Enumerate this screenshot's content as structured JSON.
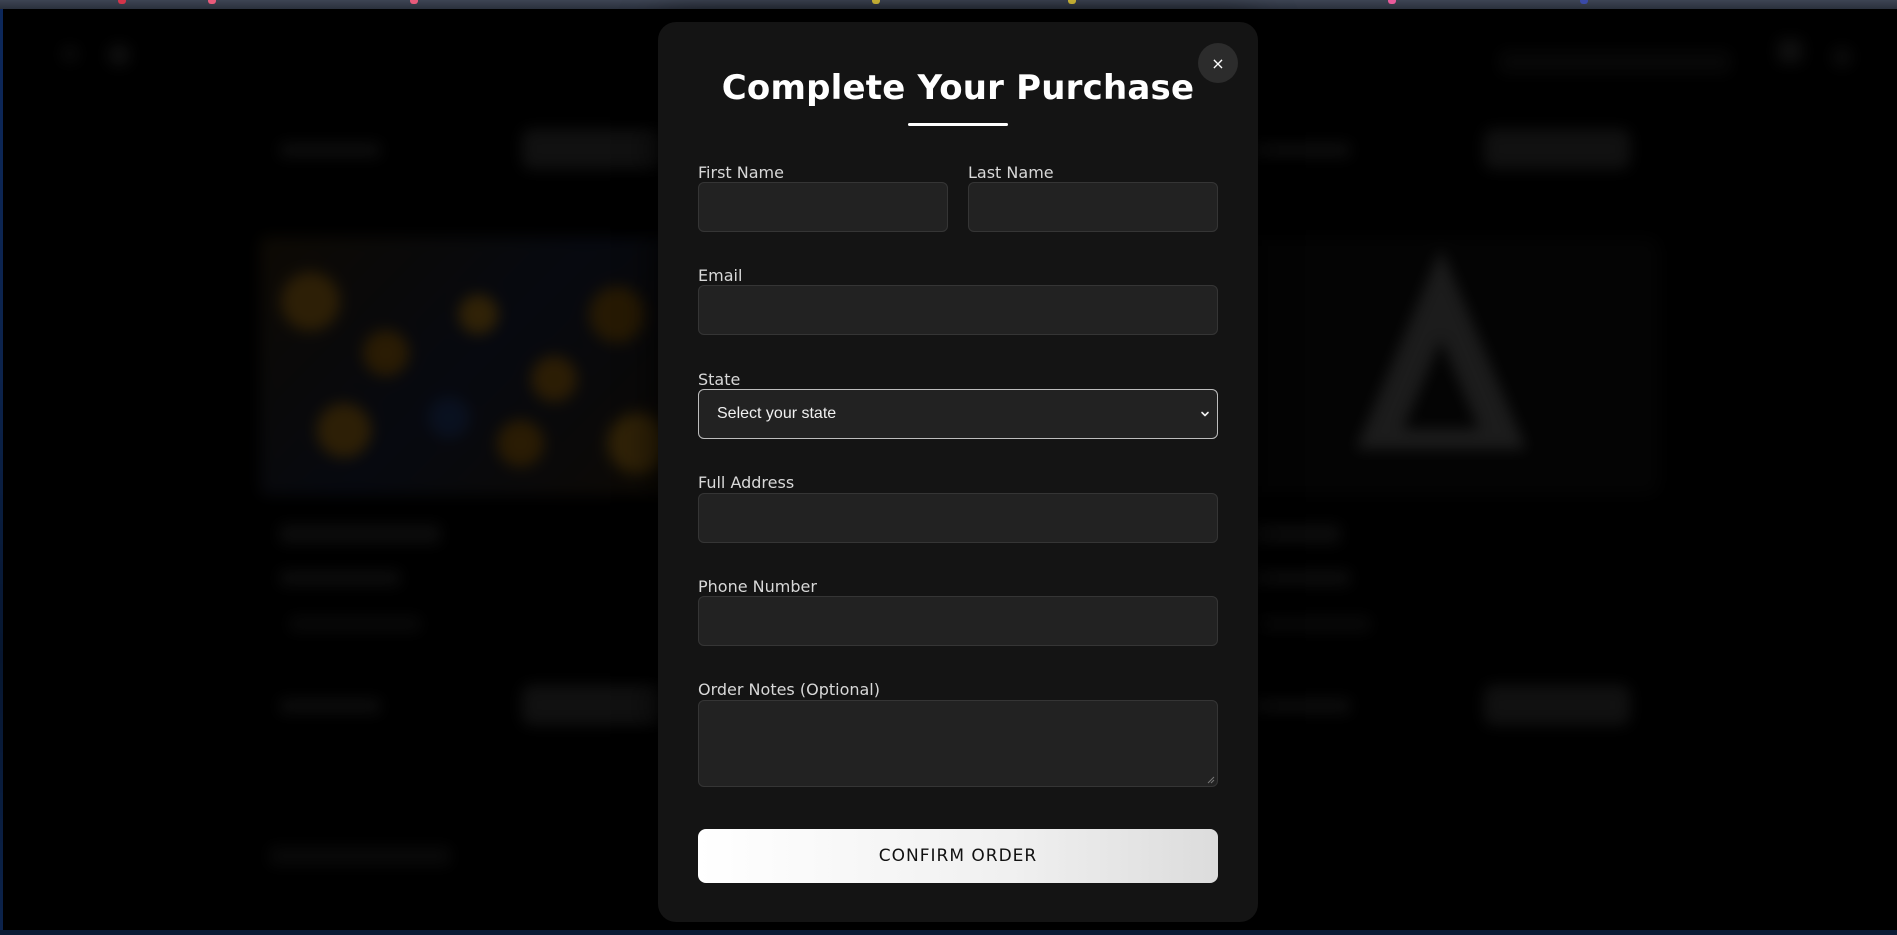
{
  "modal": {
    "title": "Complete Your Purchase",
    "close_label": "×",
    "fields": {
      "first_name": {
        "label": "First Name",
        "value": "",
        "placeholder": ""
      },
      "last_name": {
        "label": "Last Name",
        "value": "",
        "placeholder": ""
      },
      "email": {
        "label": "Email",
        "value": "",
        "placeholder": ""
      },
      "state": {
        "label": "State",
        "selected": "Select your state"
      },
      "address": {
        "label": "Full Address",
        "value": "",
        "placeholder": ""
      },
      "phone": {
        "label": "Phone Number",
        "value": "",
        "placeholder": ""
      },
      "notes": {
        "label": "Order Notes (Optional)",
        "value": "",
        "placeholder": ""
      }
    },
    "confirm_label": "CONFIRM ORDER"
  },
  "icons": {
    "close": "close-icon",
    "select_arrow": "chevron-down-icon",
    "resize": "resize-grip-icon"
  },
  "colors": {
    "page_background": "#000000",
    "modal_background": "#141414",
    "input_background": "#222222",
    "accent": "#ffffff"
  }
}
